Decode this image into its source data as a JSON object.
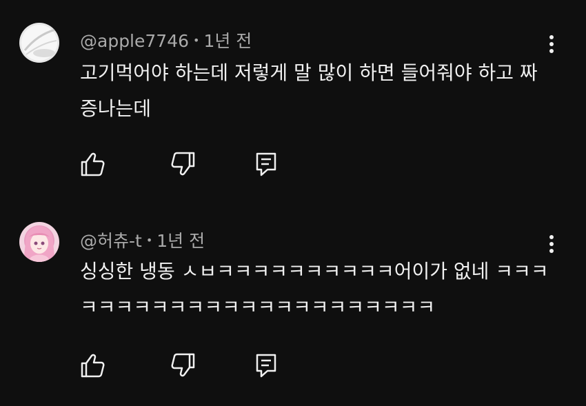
{
  "comments": [
    {
      "author": "@apple7746",
      "time": "1년 전",
      "separator": "•",
      "text": "고기먹어야 하는데 저렇게 말 많이 하면 들어줘야 하고 짜증나는데",
      "avatar_icon": "white-ball-avatar"
    },
    {
      "author": "@허츄-t",
      "time": "1년 전",
      "separator": "•",
      "text": "싱싱한 냉동 ㅅㅂㅋㅋㅋㅋㅋㅋㅋㅋㅋㅋ어이가 없네 ㅋㅋㅋㅋㅋㅋㅋㅋㅋㅋㅋㅋㅋㅋㅋㅋㅋㅋㅋㅋㅋㅋㅋ",
      "avatar_icon": "anime-girl-avatar"
    }
  ],
  "icons": {
    "like": "thumbs-up-icon",
    "dislike": "thumbs-down-icon",
    "reply": "reply-icon",
    "more": "more-vertical-icon"
  },
  "colors": {
    "background": "#0f0f0f",
    "text": "#f1f1f1",
    "meta": "#aaaaaa"
  }
}
